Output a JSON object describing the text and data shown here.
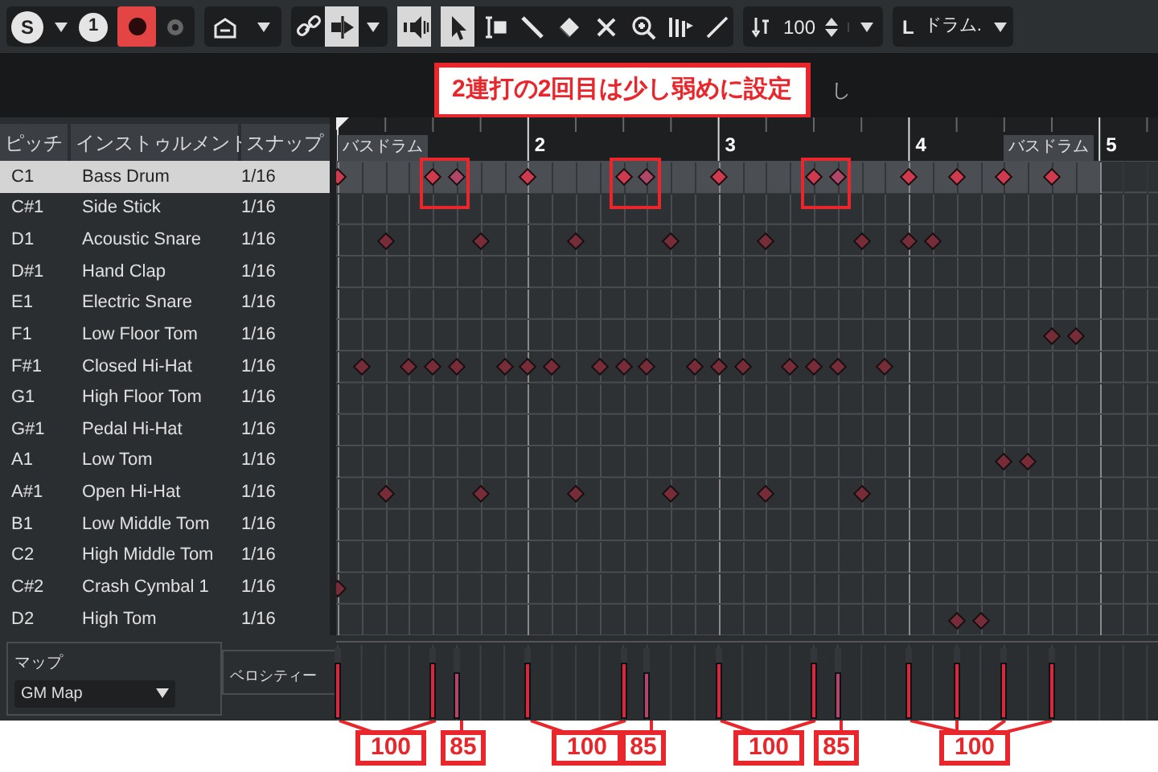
{
  "toolbar": {
    "solo_label": "S",
    "track_label": "1",
    "record_on": true,
    "monitor_on": false,
    "tools": [
      {
        "kind": "link",
        "selected": false
      },
      {
        "kind": "split",
        "selected": true
      },
      {
        "kind": "speaker",
        "selected": true
      },
      {
        "kind": "arrow",
        "selected": true
      },
      {
        "kind": "range",
        "selected": false
      },
      {
        "kind": "pencil",
        "selected": false
      },
      {
        "kind": "eraser",
        "selected": false
      },
      {
        "kind": "mute",
        "selected": false
      },
      {
        "kind": "zoom",
        "selected": false
      },
      {
        "kind": "bars",
        "selected": false
      },
      {
        "kind": "line",
        "selected": false
      }
    ],
    "velocity_value": "100",
    "drum_label": "L",
    "drum_map": "ドラム."
  },
  "info_bar": {
    "text": "し"
  },
  "callout": "2連打の2回目は少し弱めに設定",
  "columns": [
    "ピッチ",
    "インストゥルメント",
    "スナップ"
  ],
  "ruler": {
    "bars": [
      "2",
      "3",
      "4",
      "5"
    ],
    "labels": [
      "バスドラム",
      "バスドラム"
    ]
  },
  "rows": [
    {
      "pitch": "C1",
      "instrument": "Bass Drum",
      "snap": "1/16",
      "selected": true,
      "hits": [
        true,
        false,
        false,
        false,
        true,
        true,
        false,
        false,
        true,
        false,
        false,
        false,
        true,
        true,
        false,
        false,
        true,
        false,
        false,
        false,
        true,
        true,
        false,
        false,
        true,
        false,
        true,
        false,
        true,
        false,
        true,
        false
      ],
      "velocities": [
        {
          "level": 0.79
        },
        {
          "level": 0.79
        },
        {
          "level": 0.67
        },
        {
          "level": 0.79
        },
        {
          "level": 0.79
        },
        {
          "level": 0.67
        },
        {
          "level": 0.79
        },
        {
          "level": 0.79
        },
        {
          "level": 0.67
        },
        {
          "level": 0.79
        },
        {
          "level": 0.79
        },
        {
          "level": 0.79
        },
        {
          "level": 0.79
        }
      ]
    },
    {
      "pitch": "C#1",
      "instrument": "Side Stick",
      "snap": "1/16",
      "selected": false
    },
    {
      "pitch": "D1",
      "instrument": "Acoustic Snare",
      "snap": "1/16",
      "selected": false,
      "hits": [
        false,
        false,
        true,
        false,
        false,
        false,
        true,
        false,
        false,
        false,
        true,
        false,
        false,
        false,
        true,
        false,
        false,
        false,
        true,
        false,
        false,
        false,
        true,
        false,
        true,
        true,
        false,
        false,
        false,
        false,
        false,
        false
      ]
    },
    {
      "pitch": "D#1",
      "instrument": "Hand Clap",
      "snap": "1/16",
      "selected": false
    },
    {
      "pitch": "E1",
      "instrument": "Electric Snare",
      "snap": "1/16",
      "selected": false
    },
    {
      "pitch": "F1",
      "instrument": "Low Floor Tom",
      "snap": "1/16",
      "selected": false,
      "hits": [
        false,
        false,
        false,
        false,
        false,
        false,
        false,
        false,
        false,
        false,
        false,
        false,
        false,
        false,
        false,
        false,
        false,
        false,
        false,
        false,
        false,
        false,
        false,
        false,
        false,
        false,
        false,
        false,
        false,
        false,
        true,
        true
      ]
    },
    {
      "pitch": "F#1",
      "instrument": "Closed Hi-Hat",
      "snap": "1/16",
      "selected": false,
      "hits": [
        false,
        true,
        false,
        true,
        true,
        true,
        false,
        true,
        true,
        true,
        false,
        true,
        true,
        true,
        false,
        true,
        true,
        true,
        false,
        true,
        true,
        true,
        false,
        true,
        false,
        false,
        false,
        false,
        false,
        false,
        false,
        false
      ]
    },
    {
      "pitch": "G1",
      "instrument": "High Floor Tom",
      "snap": "1/16",
      "selected": false
    },
    {
      "pitch": "G#1",
      "instrument": "Pedal Hi-Hat",
      "snap": "1/16",
      "selected": false
    },
    {
      "pitch": "A1",
      "instrument": "Low Tom",
      "snap": "1/16",
      "selected": false,
      "hits": [
        false,
        false,
        false,
        false,
        false,
        false,
        false,
        false,
        false,
        false,
        false,
        false,
        false,
        false,
        false,
        false,
        false,
        false,
        false,
        false,
        false,
        false,
        false,
        false,
        false,
        false,
        false,
        false,
        true,
        true,
        false,
        false
      ]
    },
    {
      "pitch": "A#1",
      "instrument": "Open Hi-Hat",
      "snap": "1/16",
      "selected": false,
      "hits": [
        false,
        false,
        true,
        false,
        false,
        false,
        true,
        false,
        false,
        false,
        true,
        false,
        false,
        false,
        true,
        false,
        false,
        false,
        true,
        false,
        false,
        false,
        true,
        false,
        false,
        false,
        false,
        false,
        false,
        false,
        false,
        false
      ]
    },
    {
      "pitch": "B1",
      "instrument": "Low Middle Tom",
      "snap": "1/16",
      "selected": false
    },
    {
      "pitch": "C2",
      "instrument": "High Middle Tom",
      "snap": "1/16",
      "selected": false
    },
    {
      "pitch": "C#2",
      "instrument": "Crash Cymbal 1",
      "snap": "1/16",
      "selected": false,
      "hits": [
        true,
        false,
        false,
        false,
        false,
        false,
        false,
        false,
        false,
        false,
        false,
        false,
        false,
        false,
        false,
        false,
        false,
        false,
        false,
        false,
        false,
        false,
        false,
        false,
        false,
        false,
        false,
        false,
        false,
        false,
        false,
        false
      ]
    },
    {
      "pitch": "D2",
      "instrument": "High Tom",
      "snap": "1/16",
      "selected": false,
      "hits": [
        false,
        false,
        false,
        false,
        false,
        false,
        false,
        false,
        false,
        false,
        false,
        false,
        false,
        false,
        false,
        false,
        false,
        false,
        false,
        false,
        false,
        false,
        false,
        false,
        false,
        false,
        true,
        true,
        false,
        false,
        false,
        false
      ]
    }
  ],
  "map": {
    "label": "マップ",
    "value": "GM Map"
  },
  "velocity_lane": {
    "label": "ベロシティー"
  },
  "velocity_labels": [
    "100",
    "85",
    "100",
    "85",
    "100",
    "85",
    "100"
  ]
}
